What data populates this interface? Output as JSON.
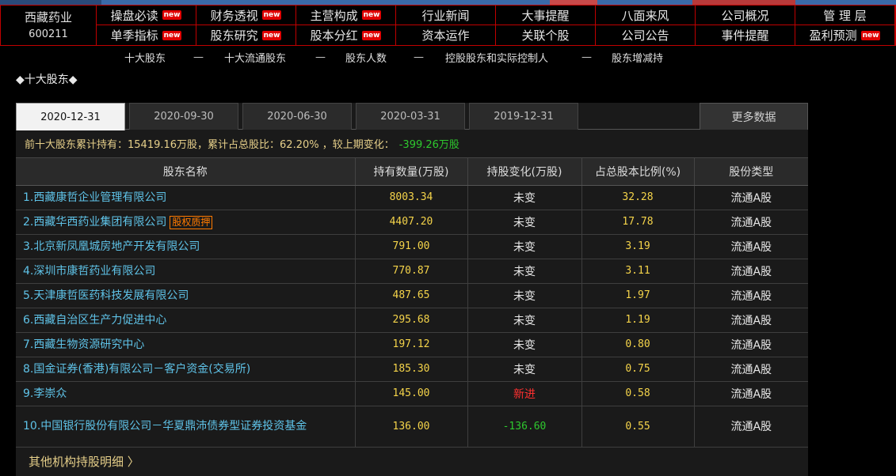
{
  "stock": {
    "name": "西藏药业",
    "code": "600211"
  },
  "nav": {
    "items": [
      {
        "label": "操盘必读",
        "new": true
      },
      {
        "label": "财务透视",
        "new": true
      },
      {
        "label": "主营构成",
        "new": true
      },
      {
        "label": "行业新闻",
        "new": false
      },
      {
        "label": "大事提醒",
        "new": false
      },
      {
        "label": "八面来风",
        "new": false
      },
      {
        "label": "公司概况",
        "new": false
      },
      {
        "label": "管 理 层",
        "new": false
      },
      {
        "label": "单季指标",
        "new": true
      },
      {
        "label": "股东研究",
        "new": true
      },
      {
        "label": "股本分红",
        "new": true
      },
      {
        "label": "资本运作",
        "new": false
      },
      {
        "label": "关联个股",
        "new": false
      },
      {
        "label": "公司公告",
        "new": false
      },
      {
        "label": "事件提醒",
        "new": false
      },
      {
        "label": "盈利预测",
        "new": true
      }
    ],
    "new_badge": "new"
  },
  "subnav": {
    "items": [
      "十大股东",
      "十大流通股东",
      "股东人数",
      "控股股东和实际控制人",
      "股东增减持"
    ],
    "separator": "—"
  },
  "section_title": "◆十大股东◆",
  "tabs": [
    "2020-12-31",
    "2020-09-30",
    "2020-06-30",
    "2020-03-31",
    "2019-12-31"
  ],
  "more_label": "更多数据",
  "summary": {
    "text": "前十大股东累计持有：15419.16万股，累计占总股比：62.20% ，较上期变化：",
    "change": "-399.26万股"
  },
  "table": {
    "headers": [
      "股东名称",
      "持有数量(万股)",
      "持股变化(万股)",
      "占总股本比例(%)",
      "股份类型"
    ],
    "rows": [
      {
        "name": "1.西藏康哲企业管理有限公司",
        "qty": "8003.34",
        "change": "未变",
        "pct": "32.28",
        "type": "流通A股"
      },
      {
        "name": "2.西藏华西药业集团有限公司",
        "pledge": "股权质押",
        "qty": "4407.20",
        "change": "未变",
        "pct": "17.78",
        "type": "流通A股"
      },
      {
        "name": "3.北京新凤凰城房地产开发有限公司",
        "qty": "791.00",
        "change": "未变",
        "pct": "3.19",
        "type": "流通A股"
      },
      {
        "name": "4.深圳市康哲药业有限公司",
        "qty": "770.87",
        "change": "未变",
        "pct": "3.11",
        "type": "流通A股"
      },
      {
        "name": "5.天津康哲医药科技发展有限公司",
        "qty": "487.65",
        "change": "未变",
        "pct": "1.97",
        "type": "流通A股"
      },
      {
        "name": "6.西藏自治区生产力促进中心",
        "qty": "295.68",
        "change": "未变",
        "pct": "1.19",
        "type": "流通A股"
      },
      {
        "name": "7.西藏生物资源研究中心",
        "qty": "197.12",
        "change": "未变",
        "pct": "0.80",
        "type": "流通A股"
      },
      {
        "name": "8.国金证券(香港)有限公司－客户资金(交易所)",
        "qty": "185.30",
        "change": "未变",
        "pct": "0.75",
        "type": "流通A股"
      },
      {
        "name": "9.李崇众",
        "qty": "145.00",
        "change": "新进",
        "pct": "0.58",
        "type": "流通A股"
      },
      {
        "name": "10.中国银行股份有限公司－华夏鼎沛债券型证券投资基金",
        "qty": "136.00",
        "change": "-136.60",
        "pct": "0.55",
        "type": "流通A股"
      }
    ]
  },
  "footer_link": "其他机构持股明细 〉",
  "colors": {
    "nav_border": "#c00000",
    "name_link": "#5fc3e8",
    "value": "#f5d44a",
    "summary": "#e7d08a",
    "negative": "#2ec82e",
    "new_entry": "#ff3030",
    "pledge": "#ff7a00"
  }
}
